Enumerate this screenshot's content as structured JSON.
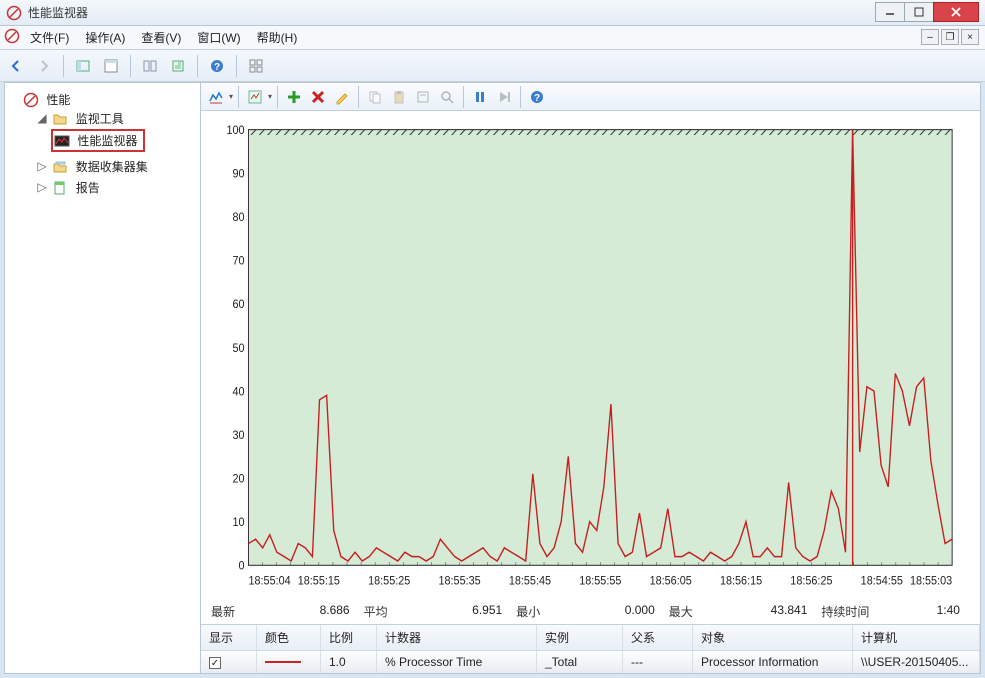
{
  "window": {
    "title": "性能监视器"
  },
  "menu": [
    {
      "label": "文件(F)"
    },
    {
      "label": "操作(A)"
    },
    {
      "label": "查看(V)"
    },
    {
      "label": "窗口(W)"
    },
    {
      "label": "帮助(H)"
    }
  ],
  "tree": {
    "root": "性能",
    "monitoring_tools": "监视工具",
    "performance_monitor": "性能监视器",
    "data_collector_sets": "数据收集器集",
    "reports": "报告"
  },
  "stats": {
    "latest_label": "最新",
    "latest": "8.686",
    "avg_label": "平均",
    "avg": "6.951",
    "min_label": "最小",
    "min": "0.000",
    "max_label": "最大",
    "max": "43.841",
    "duration_label": "持续时间",
    "duration": "1:40"
  },
  "columns": {
    "c0": "显示",
    "c1": "颜色",
    "c2": "比例",
    "c3": "计数器",
    "c4": "实例",
    "c5": "父系",
    "c6": "对象",
    "c7": "计算机"
  },
  "row": {
    "show": "✓",
    "scale": "1.0",
    "counter": "% Processor Time",
    "instance": "_Total",
    "parent": "---",
    "object": "Processor Information",
    "computer": "\\\\USER-20150405..."
  },
  "chart_data": {
    "type": "line",
    "ylim": [
      0,
      100
    ],
    "yticks": [
      0,
      10,
      20,
      30,
      40,
      50,
      60,
      70,
      80,
      90,
      100
    ],
    "xcategories": [
      "18:55:04",
      "18:55:15",
      "18:55:25",
      "18:55:35",
      "18:55:45",
      "18:55:55",
      "18:56:05",
      "18:56:15",
      "18:56:25",
      "18:54:55",
      "18:55:03"
    ],
    "wrap_index": 85,
    "series": [
      {
        "name": "% Processor Time",
        "color": "#c42020",
        "values": [
          5,
          6,
          4,
          7,
          3,
          2,
          1,
          5,
          4,
          2,
          38,
          39,
          8,
          2,
          1,
          3,
          1,
          2,
          4,
          3,
          2,
          1,
          3,
          2,
          2,
          1,
          2,
          6,
          4,
          2,
          1,
          2,
          3,
          4,
          2,
          1,
          4,
          3,
          2,
          1,
          21,
          5,
          2,
          4,
          10,
          25,
          5,
          3,
          10,
          8,
          18,
          37,
          5,
          2,
          3,
          12,
          2,
          3,
          4,
          13,
          2,
          2,
          3,
          2,
          1,
          3,
          2,
          1,
          2,
          5,
          10,
          2,
          2,
          4,
          2,
          2,
          19,
          4,
          2,
          1,
          2,
          8,
          17,
          13,
          3,
          100,
          26,
          41,
          40,
          23,
          18,
          44,
          40,
          32,
          41,
          43,
          24,
          14,
          5,
          6
        ]
      }
    ]
  }
}
